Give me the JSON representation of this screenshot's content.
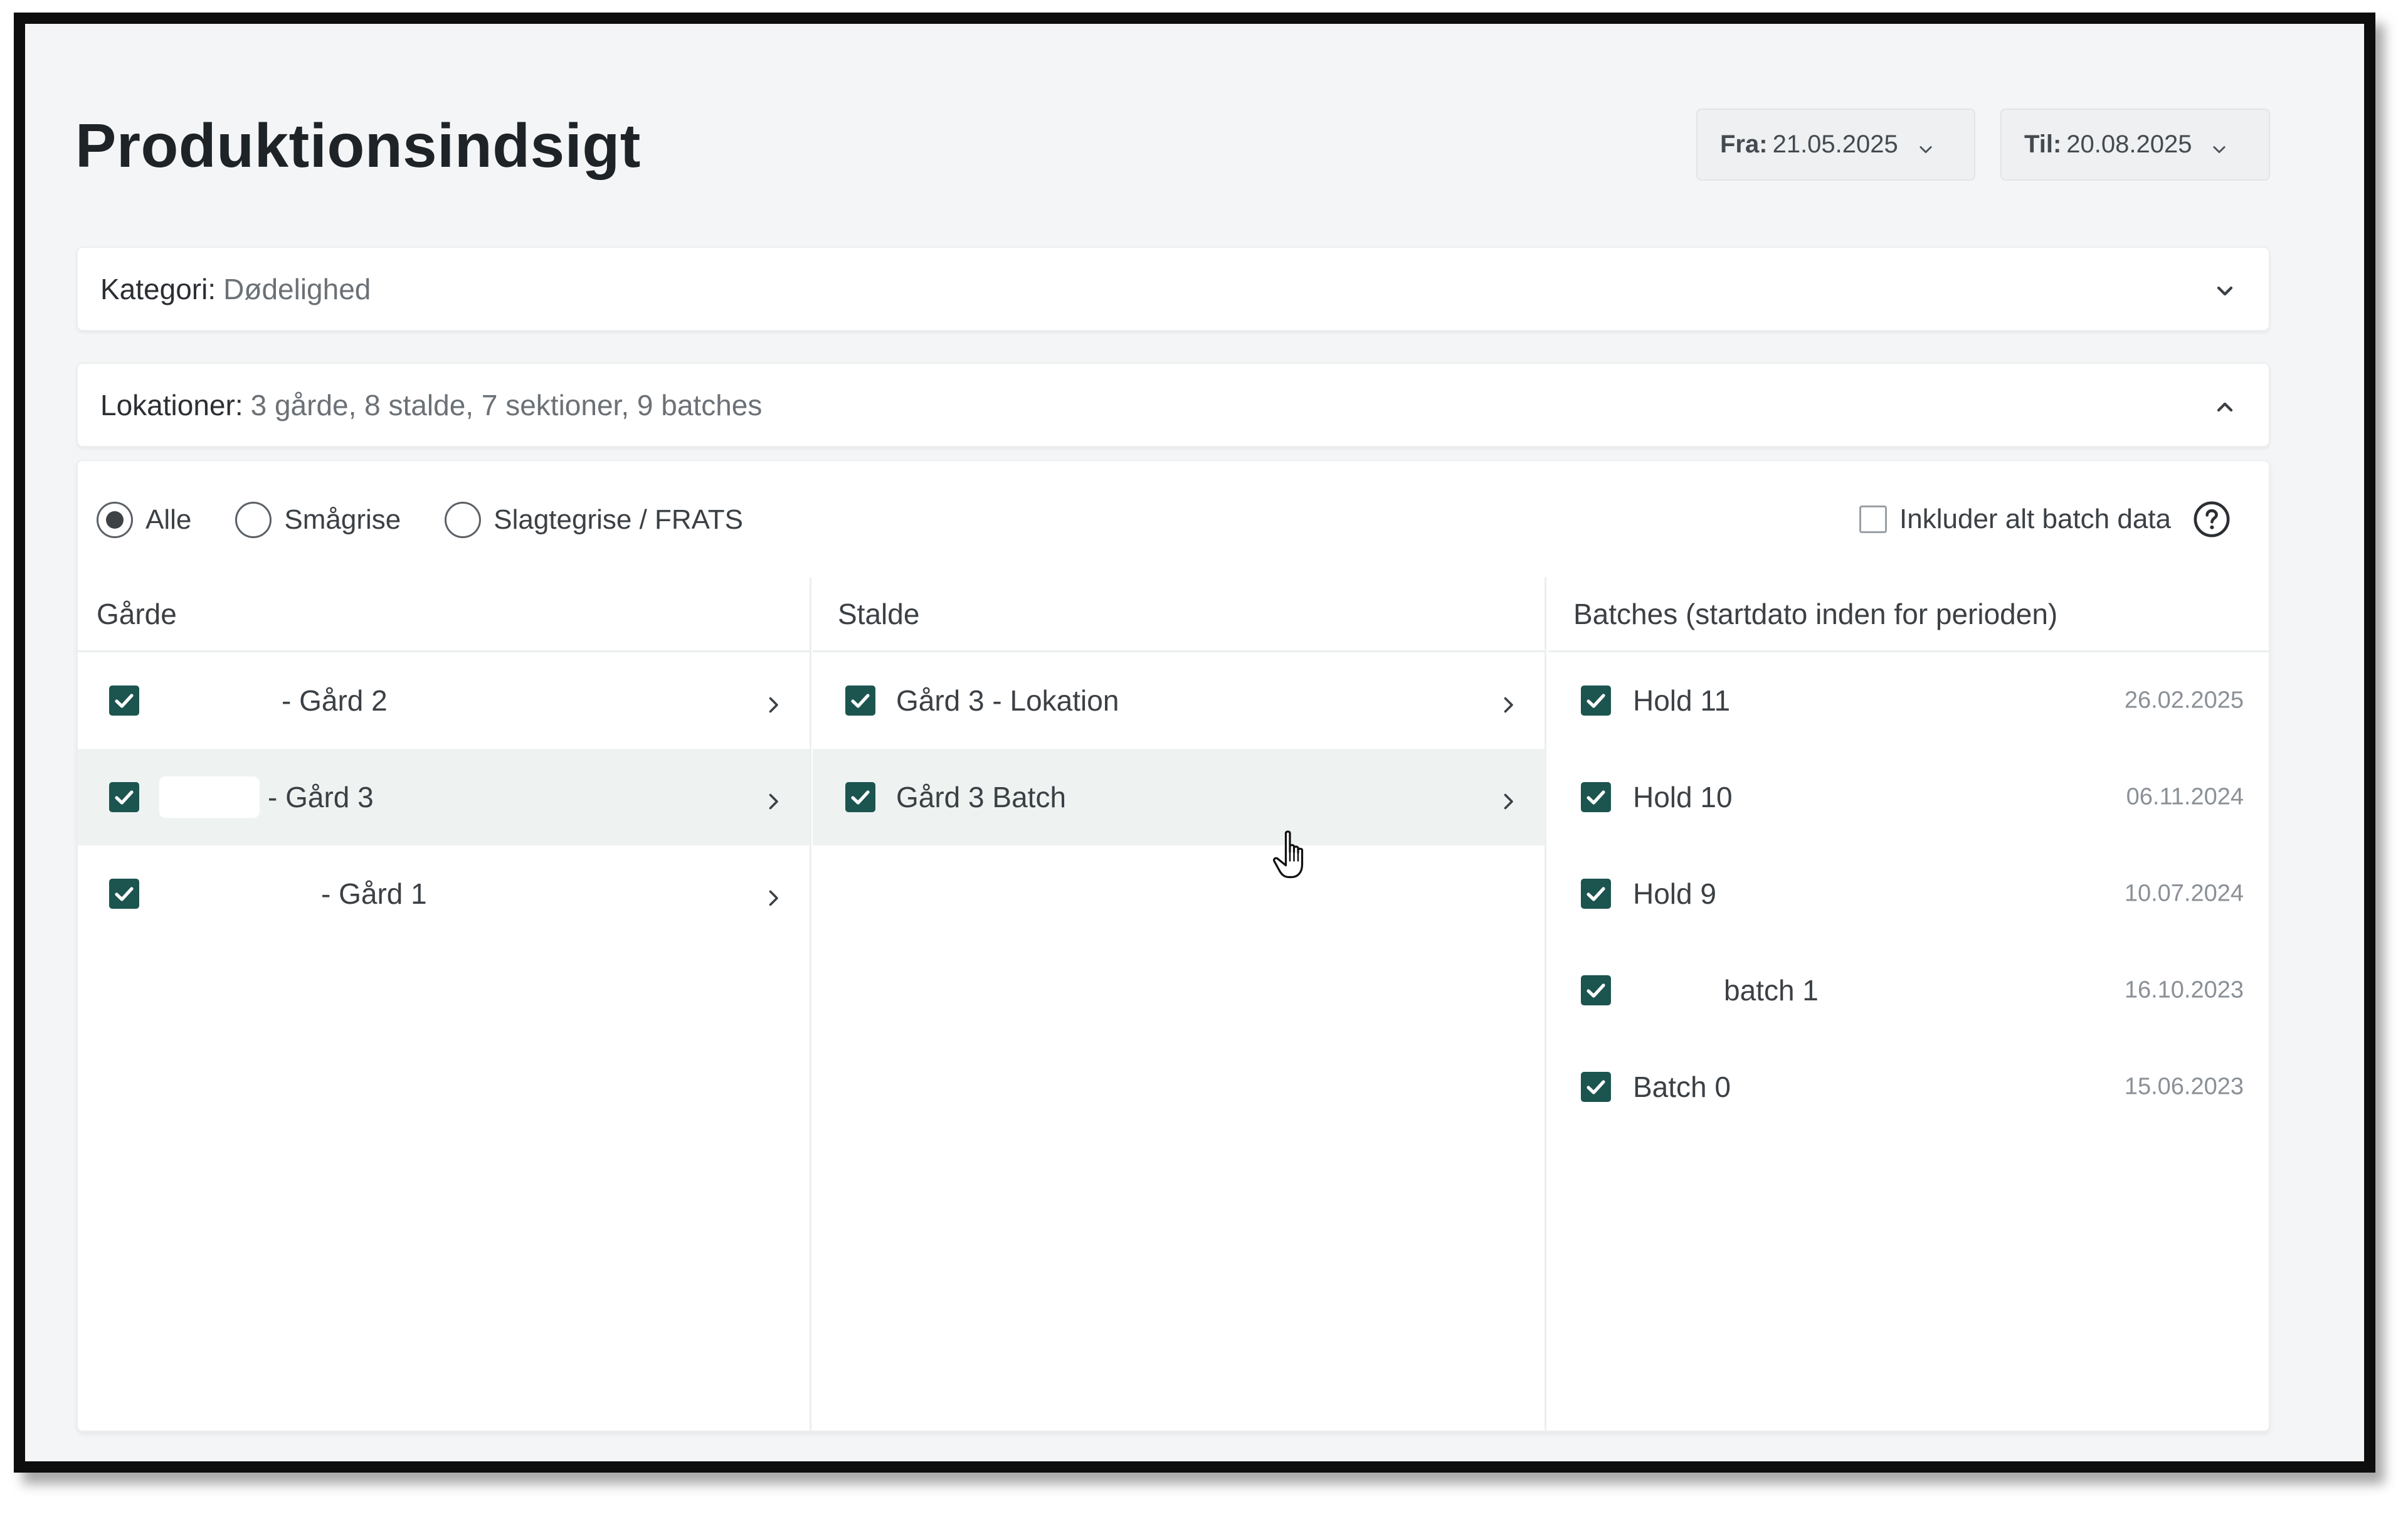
{
  "header": {
    "title": "Produktionsindsigt",
    "date_from": {
      "label": "Fra:",
      "value": "21.05.2025"
    },
    "date_to": {
      "label": "Til:",
      "value": "20.08.2025"
    }
  },
  "category": {
    "label": "Kategori:",
    "value": "Dødelighed"
  },
  "locations": {
    "label": "Lokationer:",
    "value": "3 gårde, 8 stalde, 7 sektioner, 9 batches"
  },
  "filters": {
    "radios": [
      {
        "label": "Alle",
        "checked": true
      },
      {
        "label": "Smågrise",
        "checked": false
      },
      {
        "label": "Slagtegrise / FRATS",
        "checked": false
      }
    ],
    "include_all_batch": {
      "label": "Inkluder alt batch data",
      "checked": false
    }
  },
  "columns": {
    "farms": {
      "header": "Gårde",
      "items": [
        {
          "label": "- Gård 2",
          "checked": true
        },
        {
          "label": "- Gård 3",
          "checked": true,
          "active": true
        },
        {
          "label": "- Gård 1",
          "checked": true
        }
      ]
    },
    "stables": {
      "header": "Stalde",
      "items": [
        {
          "label": "Gård 3 - Lokation",
          "checked": true
        },
        {
          "label": "Gård 3 Batch",
          "checked": true,
          "active": true
        }
      ]
    },
    "batches": {
      "header": "Batches (startdato inden for perioden)",
      "items": [
        {
          "label": "Hold 11",
          "date": "26.02.2025",
          "checked": true
        },
        {
          "label": "Hold 10",
          "date": "06.11.2024",
          "checked": true
        },
        {
          "label": "Hold 9",
          "date": "10.07.2024",
          "checked": true
        },
        {
          "label": "batch 1",
          "date": "16.10.2023",
          "checked": true
        },
        {
          "label": "Batch 0",
          "date": "15.06.2023",
          "checked": true
        }
      ]
    }
  },
  "colors": {
    "checkbox_fill": "#1c5450",
    "active_row": "#eef3f2",
    "page_bg": "#f4f5f6"
  },
  "icons": [
    "chevron-down-icon",
    "chevron-up-icon",
    "chevron-right-icon",
    "checkmark-icon",
    "help-icon",
    "hand-cursor-icon"
  ]
}
